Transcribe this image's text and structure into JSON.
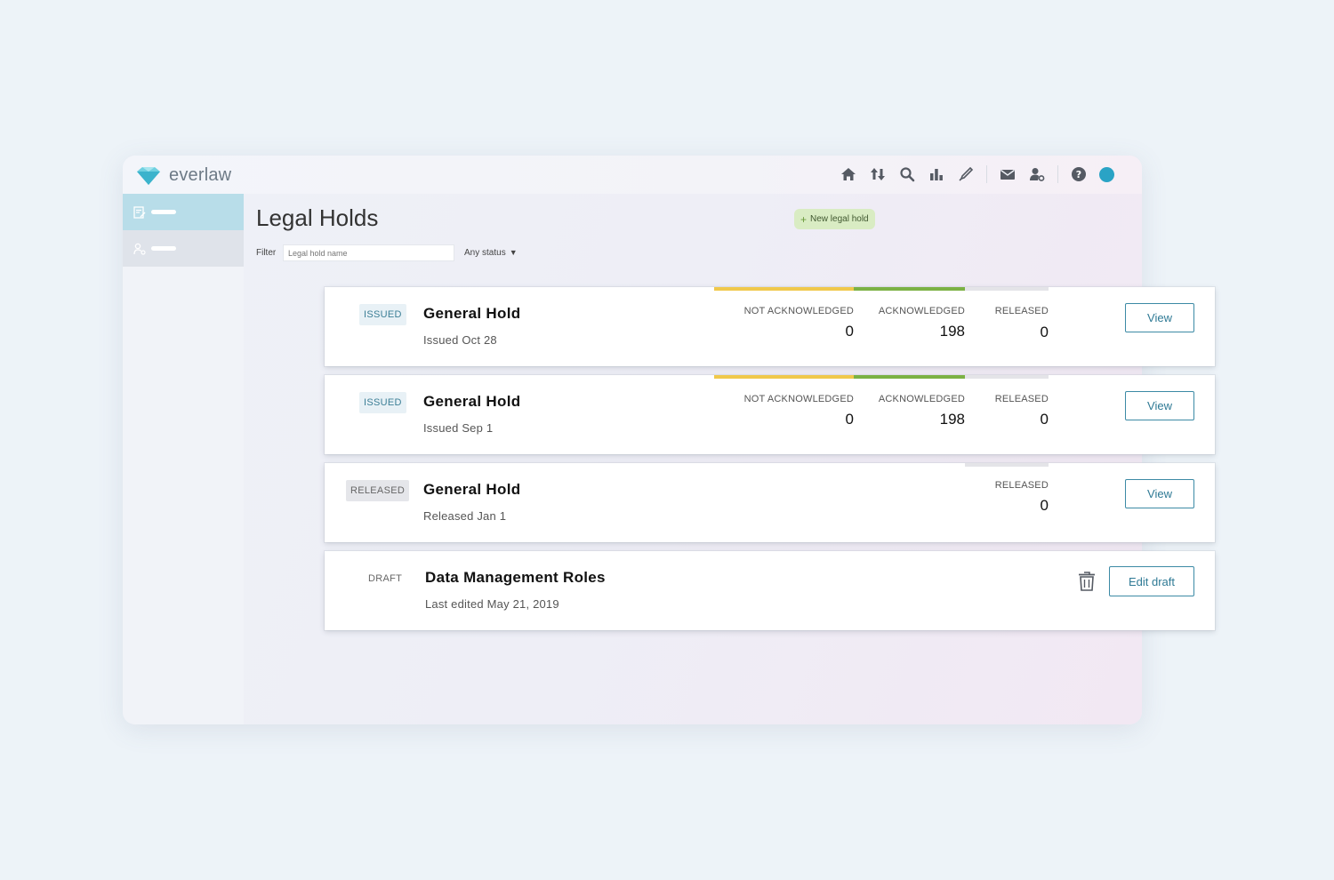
{
  "app": {
    "logo_text": "everlaw"
  },
  "nav": {
    "icons": [
      "home-icon",
      "transfer-icon",
      "search-icon",
      "bar-chart-icon",
      "pen-icon",
      "mail-icon",
      "user-settings-icon",
      "help-icon",
      "avatar"
    ]
  },
  "sidebar": {
    "items": [
      {
        "icon": "legal-hold-icon",
        "active": true
      },
      {
        "icon": "user-icon",
        "active": false
      }
    ]
  },
  "page": {
    "title": "Legal Holds",
    "new_button": "New legal hold",
    "filter_label": "Filter",
    "filter_placeholder": "Legal hold name",
    "status_select": "Any status"
  },
  "colors": {
    "not_ack": "#f0c84b",
    "ack": "#7bb144",
    "released": "#e4e4e8",
    "accent": "#3c8aa5"
  },
  "holds": [
    {
      "badge": "ISSUED",
      "title": "General Hold",
      "subtitle": "Issued Oct 28",
      "stats": {
        "not_ack_label": "NOT ACKNOWLEDGED",
        "not_ack": "0",
        "ack_label": "ACKNOWLEDGED",
        "ack": "198",
        "released_label": "RELEASED",
        "released": "0"
      },
      "action": "View"
    },
    {
      "badge": "ISSUED",
      "title": "General Hold",
      "subtitle": "Issued Sep 1",
      "stats": {
        "not_ack_label": "NOT ACKNOWLEDGED",
        "not_ack": "0",
        "ack_label": "ACKNOWLEDGED",
        "ack": "198",
        "released_label": "RELEASED",
        "released": "0"
      },
      "action": "View"
    },
    {
      "badge": "RELEASED",
      "title": "General Hold",
      "subtitle": "Released Jan 1",
      "stats": {
        "released_label": "RELEASED",
        "released": "0"
      },
      "action": "View"
    },
    {
      "badge": "DRAFT",
      "title": "Data Management Roles",
      "subtitle": "Last edited May 21, 2019",
      "action": "Edit draft"
    }
  ]
}
